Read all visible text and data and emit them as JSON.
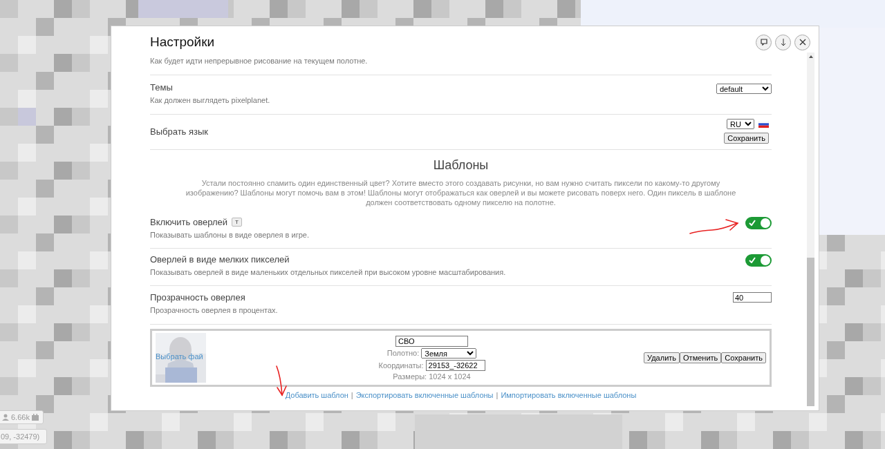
{
  "modal": {
    "title": "Настройки",
    "header_buttons": [
      {
        "kind": "chat"
      },
      {
        "kind": "download"
      },
      {
        "kind": "close"
      }
    ]
  },
  "partial_row": {
    "description": "Как будет идти непрерывное рисование на текущем полотне."
  },
  "settings": [
    {
      "kind": "select",
      "title": "Темы",
      "description": "Как должен выглядеть pixelplanet.",
      "value": "default"
    },
    {
      "kind": "language",
      "title": "Выбрать язык",
      "value": "RU",
      "button": "Сохранить"
    }
  ],
  "templates": {
    "heading": "Шаблоны",
    "intro": "Устали постоянно спамить один единственный цвет? Хотите вместо этого создавать рисунки, но вам нужно считать пиксели по какому-то другому изображению? Шаблоны могут помочь вам в этом! Шаблоны могут отображаться как оверлей и вы можете рисовать поверх него. Один пиксель в шаблоне должен соответствовать одному пикселю на полотне.",
    "settings": [
      {
        "kind": "toggle",
        "title": "Включить оверлей",
        "hotkey": "T",
        "description": "Показывать шаблоны в виде оверлея в игре.",
        "on": true
      },
      {
        "kind": "toggle",
        "title": "Оверлей в виде мелких пикселей",
        "description": "Показывать оверлей в виде маленьких отдельных пикселей при высоком уровне масштабирования.",
        "on": true
      },
      {
        "kind": "number",
        "title": "Прозрачность оверлея",
        "description": "Прозрачность оверлея в процентах.",
        "value": "40"
      }
    ],
    "items": [
      {
        "file_link": "Выбрать фай",
        "name": "СВО",
        "canvas_label": "Полотно:",
        "canvas": "Земля",
        "coords_label": "Координаты:",
        "coords": "29153_-32622",
        "size": "Размеры: 1024 x 1024",
        "buttons": [
          "Удалить",
          "Отменить",
          "Сохранить"
        ]
      }
    ],
    "links": [
      "Добавить шаблон",
      "Экспортировать включенные шаблоны",
      "Импортировать включенные шаблоны"
    ],
    "separator": "|"
  },
  "overlay": {
    "online": "6.66k",
    "coordinates": "09, -32479)"
  }
}
